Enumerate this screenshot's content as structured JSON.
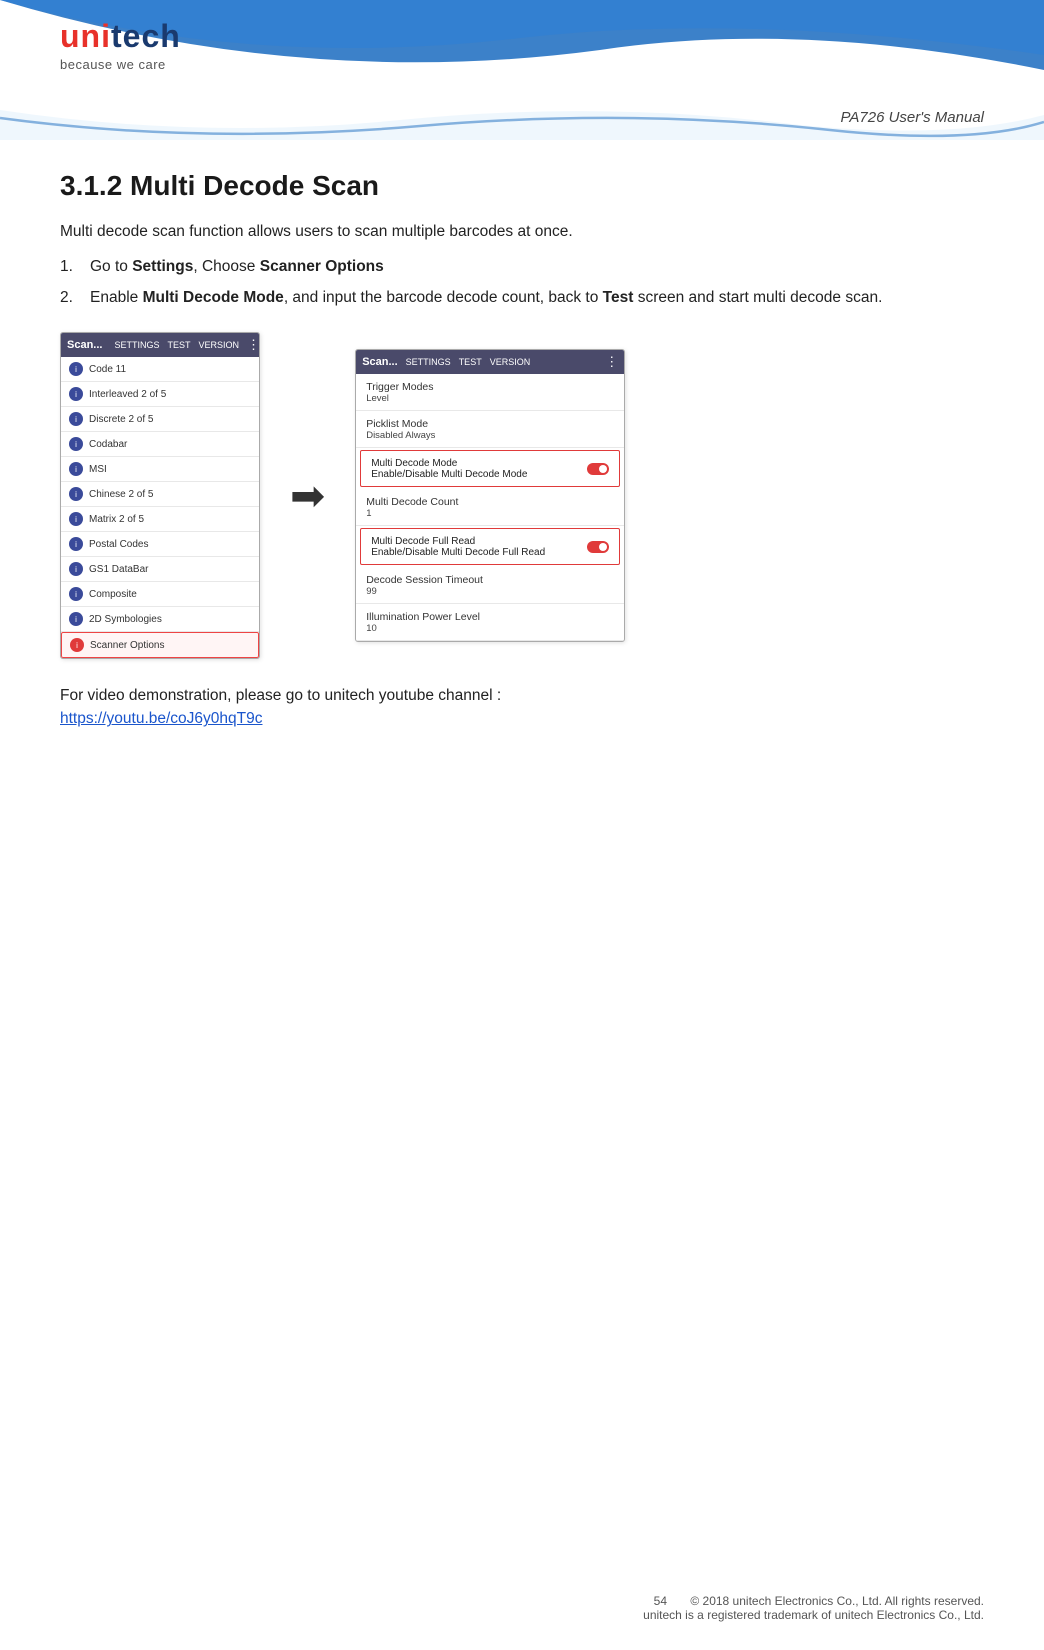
{
  "header": {
    "logo_main": "unitech",
    "logo_highlight": "uni",
    "tagline": "because we care",
    "manual_title": "PA726 User's Manual"
  },
  "section": {
    "title": "3.1.2 Multi Decode Scan",
    "intro": "Multi decode scan function allows users to scan multiple barcodes at once.",
    "step1": "Go to Settings, Choose Scanner Options",
    "step2_pre": "Enable ",
    "step2_bold": "Multi Decode Mode",
    "step2_post": ", and input the barcode decode count, back to Test screen and start multi decode scan.",
    "step1_bold_settings": "Settings",
    "step1_bold_options": "Scanner Options"
  },
  "left_screen": {
    "toolbar_scan": "Scan...",
    "toolbar_settings": "SETTINGS",
    "toolbar_test": "TEST",
    "toolbar_version": "VERSION",
    "items": [
      "Code 11",
      "Interleaved 2 of 5",
      "Discrete 2 of 5",
      "Codabar",
      "MSI",
      "Chinese 2 of 5",
      "Matrix 2 of 5",
      "Postal Codes",
      "GS1 DataBar",
      "Composite",
      "2D Symbologies",
      "Scanner Options"
    ],
    "selected_item": "Scanner Options"
  },
  "right_screen": {
    "toolbar_scan": "Scan...",
    "toolbar_settings": "SETTINGS",
    "toolbar_test": "TEST",
    "toolbar_version": "VERSION",
    "rows": [
      {
        "title": "Trigger Modes",
        "sub": "Level",
        "type": "plain"
      },
      {
        "title": "Picklist Mode",
        "sub": "Disabled Always",
        "type": "plain"
      },
      {
        "title": "Multi Decode Mode",
        "sub": "Enable/Disable Multi Decode Mode",
        "type": "toggle-on",
        "highlighted": true
      },
      {
        "title": "Multi Decode Count",
        "sub": "1",
        "type": "plain"
      },
      {
        "title": "Multi Decode Full Read",
        "sub": "Enable/Disable Multi Decode Full Read",
        "type": "toggle-on",
        "highlighted": true
      },
      {
        "title": "Decode Session Timeout",
        "sub": "99",
        "type": "plain"
      },
      {
        "title": "Illumination Power Level",
        "sub": "10",
        "type": "plain"
      }
    ]
  },
  "video": {
    "text": "For video demonstration, please go to unitech youtube channel :",
    "link": "https://youtu.be/coJ6y0hqT9c"
  },
  "footer": {
    "page_num": "54",
    "line1": "© 2018 unitech Electronics Co., Ltd. All rights reserved.",
    "line2": "unitech is a registered trademark of unitech Electronics Co., Ltd."
  }
}
